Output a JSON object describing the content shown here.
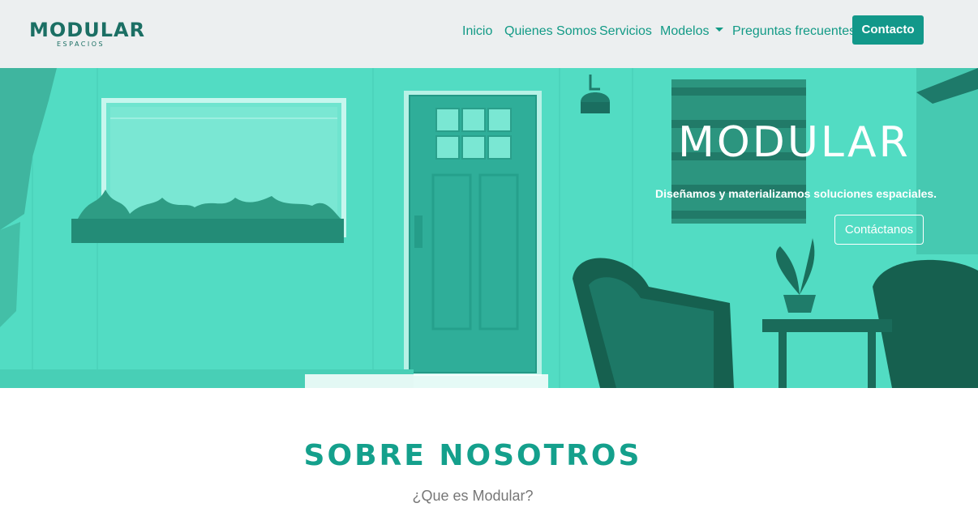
{
  "header": {
    "logo": {
      "word": "MODULAR",
      "sub": "ESPACIOS"
    },
    "nav": {
      "inicio": "Inicio",
      "quienes": "Quienes Somos",
      "servicios": "Servicios",
      "modelos": "Modelos",
      "faq": "Preguntas frecuentes",
      "contacto": "Contacto"
    }
  },
  "hero": {
    "title": "MODULAR",
    "subtitle": "Diseñamos y materializamos soluciones espaciales.",
    "button": "Contáctanos"
  },
  "about": {
    "title": "SOBRE NOSOTROS",
    "subtitle": "¿Que es Modular?"
  },
  "colors": {
    "accent": "#12988a",
    "navbar_bg": "#eceff0",
    "hero_tint": "#4cd8bf",
    "heading": "#14a08c"
  },
  "icons": [
    "chevron-down-icon"
  ]
}
